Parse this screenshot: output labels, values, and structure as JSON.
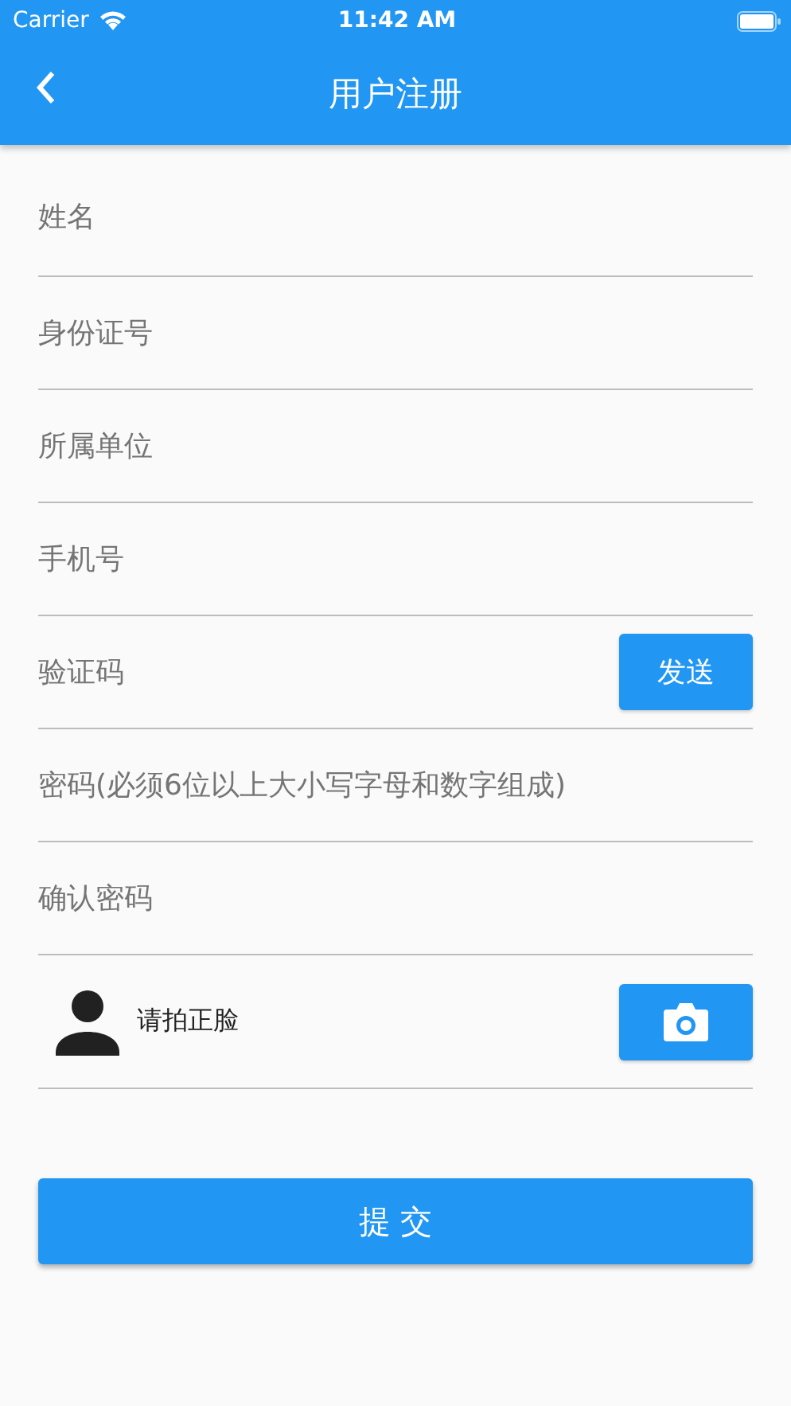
{
  "status_bar": {
    "carrier": "Carrier",
    "time": "11:42 AM"
  },
  "nav_bar": {
    "title": "用户注册"
  },
  "fields": [
    {
      "kind": "text",
      "placeholder": "姓名"
    },
    {
      "kind": "text",
      "placeholder": "身份证号"
    },
    {
      "kind": "text",
      "placeholder": "所属单位"
    },
    {
      "kind": "text",
      "placeholder": "手机号"
    },
    {
      "kind": "code",
      "placeholder": "验证码",
      "button": "发送"
    },
    {
      "kind": "password",
      "placeholder": "密码(必须6位以上大小写字母和数字组成)"
    },
    {
      "kind": "password",
      "placeholder": "确认密码"
    }
  ],
  "photo": {
    "label": "请拍正脸"
  },
  "submit_button": "提 交"
}
